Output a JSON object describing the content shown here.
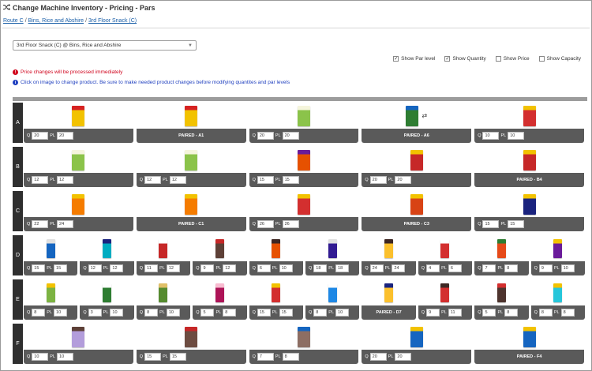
{
  "header": {
    "title": "Change Machine Inventory - Pricing - Pars"
  },
  "breadcrumb": {
    "items": [
      "Route C",
      "Bins, Rice and Abshire",
      "3rd Floor Snack (C)"
    ]
  },
  "machine_select": {
    "value": "3rd Floor Snack (C) @ Bins, Rice and Abshire"
  },
  "toggles": [
    {
      "label": "Show Par level",
      "checked": true
    },
    {
      "label": "Show Quantity",
      "checked": true
    },
    {
      "label": "Show Price",
      "checked": false
    },
    {
      "label": "Show Capacity",
      "checked": false
    }
  ],
  "notices": {
    "price": "Price changes will be processed immediately",
    "product": "Click on image to change product. Be sure to make needed product changes before modifying quantites and par levels"
  },
  "labels": {
    "q": "Q",
    "pl": "PL"
  },
  "colors": {
    "notice_red": "#d0021b",
    "notice_blue": "#1f3fbf",
    "bar": "#5a5a5a",
    "row_label": "#2f2f2f"
  },
  "rows": [
    {
      "label": "A",
      "slots": [
        {
          "q": "20",
          "pl": "20",
          "product": {
            "color": "#f2c200",
            "accent": "#d62222"
          }
        },
        {
          "paired": "PAIRED - A1",
          "product": {
            "color": "#f2c200",
            "accent": "#d62222"
          }
        },
        {
          "q": "20",
          "pl": "20",
          "product": {
            "color": "#8bc34a",
            "accent": "#f5f5dc"
          }
        },
        {
          "paired": "PAIRED - A6",
          "product": {
            "color": "#2e7d32",
            "accent": "#1565c0"
          },
          "pair_icon": true
        },
        {
          "q": "10",
          "pl": "10",
          "product": {
            "color": "#d32f2f",
            "accent": "#f2c200"
          }
        }
      ]
    },
    {
      "label": "B",
      "slots": [
        {
          "q": "12",
          "pl": "12",
          "product": {
            "color": "#8bc34a",
            "accent": "#f5f5dc"
          }
        },
        {
          "q": "12",
          "pl": "12",
          "product": {
            "color": "#8bc34a",
            "accent": "#f5f5dc"
          }
        },
        {
          "q": "15",
          "pl": "15",
          "product": {
            "color": "#e65100",
            "accent": "#6a1b9a"
          }
        },
        {
          "q": "20",
          "pl": "20",
          "product": {
            "color": "#c62828",
            "accent": "#f2c200"
          }
        },
        {
          "paired": "PAIRED - B4",
          "product": {
            "color": "#c62828",
            "accent": "#f2c200"
          }
        }
      ]
    },
    {
      "label": "C",
      "slots": [
        {
          "q": "22",
          "pl": "24",
          "product": {
            "color": "#f57c00",
            "accent": "#f2c200"
          }
        },
        {
          "paired": "PAIRED - C1",
          "product": {
            "color": "#f57c00",
            "accent": "#f2c200"
          }
        },
        {
          "q": "26",
          "pl": "26",
          "product": {
            "color": "#d32f2f",
            "accent": "#f2c200"
          }
        },
        {
          "paired": "PAIRED - C3",
          "product": {
            "color": "#d84315",
            "accent": "#f2c200"
          }
        },
        {
          "q": "15",
          "pl": "15",
          "product": {
            "color": "#1a237e",
            "accent": "#f2c200"
          }
        }
      ]
    },
    {
      "label": "D",
      "slots": [
        {
          "q": "15",
          "pl": "15",
          "product": {
            "color": "#1565c0",
            "accent": "#e0e0e0"
          }
        },
        {
          "q": "12",
          "pl": "12",
          "product": {
            "color": "#00acc1",
            "accent": "#1a237e"
          }
        },
        {
          "q": "11",
          "pl": "12",
          "product": {
            "color": "#c62828",
            "accent": "#ffffff"
          }
        },
        {
          "q": "9",
          "pl": "12",
          "product": {
            "color": "#5d4037",
            "accent": "#c62828"
          }
        },
        {
          "q": "6",
          "pl": "10",
          "product": {
            "color": "#e65100",
            "accent": "#3e2723"
          }
        },
        {
          "q": "18",
          "pl": "18",
          "product": {
            "color": "#311b92",
            "accent": "#e0e0e0"
          }
        },
        {
          "q": "24",
          "pl": "24",
          "product": {
            "color": "#fbc02d",
            "accent": "#3e2723"
          }
        },
        {
          "q": "4",
          "pl": "6",
          "product": {
            "color": "#d32f2f",
            "accent": "#ffffff"
          }
        },
        {
          "q": "7",
          "pl": "8",
          "product": {
            "color": "#e64a19",
            "accent": "#2e7d32"
          }
        },
        {
          "q": "9",
          "pl": "10",
          "product": {
            "color": "#6a1b9a",
            "accent": "#f2c200"
          }
        }
      ]
    },
    {
      "label": "E",
      "slots": [
        {
          "q": "8",
          "pl": "10",
          "product": {
            "color": "#7cb342",
            "accent": "#f2c200"
          }
        },
        {
          "q": "3",
          "pl": "10",
          "product": {
            "color": "#2e7d32",
            "accent": "#ffffff"
          }
        },
        {
          "q": "8",
          "pl": "10",
          "product": {
            "color": "#558b2f",
            "accent": "#e0c068"
          }
        },
        {
          "q": "5",
          "pl": "8",
          "product": {
            "color": "#ad1457",
            "accent": "#f8bbd0"
          }
        },
        {
          "q": "15",
          "pl": "15",
          "product": {
            "color": "#d32f2f",
            "accent": "#f2c200"
          }
        },
        {
          "q": "8",
          "pl": "10",
          "product": {
            "color": "#1e88e5",
            "accent": "#ffffff"
          }
        },
        {
          "paired": "PAIRED - D7",
          "product": {
            "color": "#fbc02d",
            "accent": "#1a237e"
          }
        },
        {
          "q": "9",
          "pl": "11",
          "product": {
            "color": "#d32f2f",
            "accent": "#3e2723"
          }
        },
        {
          "q": "5",
          "pl": "8",
          "product": {
            "color": "#4e342e",
            "accent": "#d32f2f"
          }
        },
        {
          "q": "8",
          "pl": "8",
          "product": {
            "color": "#26c6da",
            "accent": "#f2c200"
          }
        }
      ]
    },
    {
      "label": "F",
      "slots": [
        {
          "q": "10",
          "pl": "10",
          "product": {
            "color": "#b39ddb",
            "accent": "#5d4037"
          }
        },
        {
          "q": "15",
          "pl": "15",
          "product": {
            "color": "#6d4c41",
            "accent": "#c62828"
          }
        },
        {
          "q": "7",
          "pl": "8",
          "product": {
            "color": "#8d6e63",
            "accent": "#1565c0"
          }
        },
        {
          "q": "20",
          "pl": "20",
          "product": {
            "color": "#1565c0",
            "accent": "#f2c200"
          }
        },
        {
          "paired": "PAIRED - F4",
          "product": {
            "color": "#1565c0",
            "accent": "#f2c200"
          }
        }
      ]
    }
  ]
}
